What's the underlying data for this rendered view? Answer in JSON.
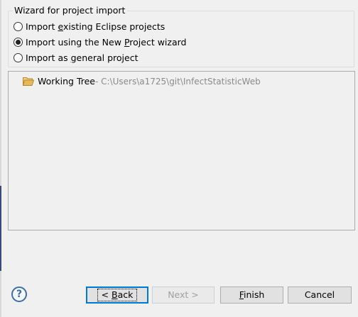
{
  "import_group": {
    "title": "Wizard for project import",
    "options": [
      {
        "pre": "Import ",
        "mnemonic": "e",
        "post": "xisting Eclipse projects",
        "checked": false
      },
      {
        "pre": "Import using the New ",
        "mnemonic": "P",
        "post": "roject wizard",
        "checked": true
      },
      {
        "pre": "Import as ",
        "mnemonic": "g",
        "post": "eneral project",
        "checked": false
      }
    ]
  },
  "tree": {
    "item_label": "Working Tree",
    "item_path": " - C:\\Users\\a1725\\git\\InfectStatisticWeb",
    "folder_color": "#e6b85a"
  },
  "buttons": {
    "help": "?",
    "back_pre": "< ",
    "back_mnemonic": "B",
    "back_post": "ack",
    "next": "Next >",
    "finish_mnemonic": "F",
    "finish_post": "inish",
    "cancel": "Cancel"
  },
  "colors": {
    "accent": "#0078d7",
    "help": "#3c6ea8"
  }
}
